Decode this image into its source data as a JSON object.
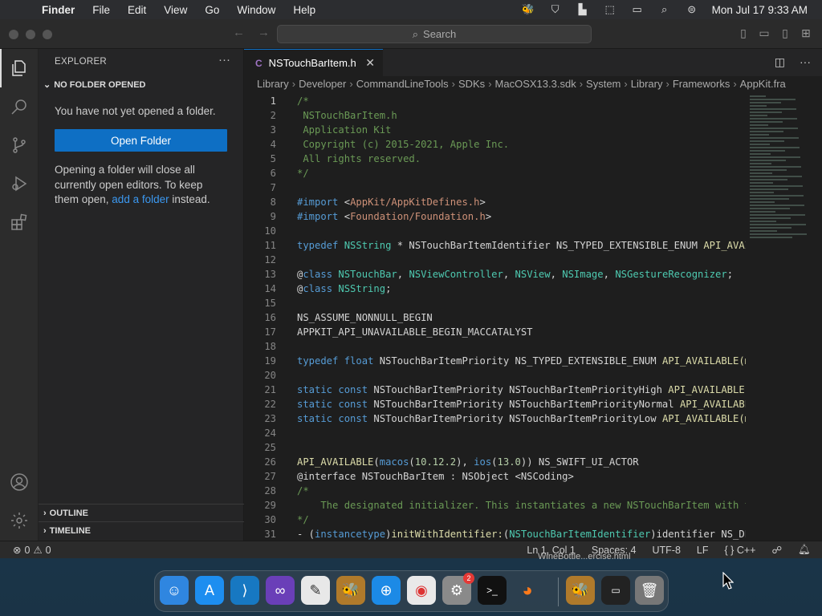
{
  "menubar": {
    "app_name": "Finder",
    "items": [
      "File",
      "Edit",
      "View",
      "Go",
      "Window",
      "Help"
    ],
    "clock": "Mon Jul 17  9:33 AM"
  },
  "titlebar": {
    "search_placeholder": "Search"
  },
  "sidebar": {
    "title": "EXPLORER",
    "more": "···",
    "section": "NO FOLDER OPENED",
    "message": "You have not yet opened a folder.",
    "open_button": "Open Folder",
    "info_before": "Opening a folder will close all currently open editors. To keep them open, ",
    "info_link": "add a folder",
    "info_after": " instead.",
    "outline": "OUTLINE",
    "timeline": "TIMELINE"
  },
  "editor": {
    "tab_lang": "C",
    "tab_label": "NSTouchBarItem.h",
    "breadcrumb": [
      "Library",
      "Developer",
      "CommandLineTools",
      "SDKs",
      "MacOSX13.3.sdk",
      "System",
      "Library",
      "Frameworks",
      "AppKit.fra"
    ],
    "lines": [
      {
        "n": "1",
        "html": "<span class='cm'>/*</span>"
      },
      {
        "n": "2",
        "html": "<span class='cm'> NSTouchBarItem.h</span>"
      },
      {
        "n": "3",
        "html": "<span class='cm'> Application Kit</span>"
      },
      {
        "n": "4",
        "html": "<span class='cm'> Copyright (c) 2015-2021, Apple Inc.</span>"
      },
      {
        "n": "5",
        "html": "<span class='cm'> All rights reserved.</span>"
      },
      {
        "n": "6",
        "html": "<span class='cm'>*/</span>"
      },
      {
        "n": "7",
        "html": ""
      },
      {
        "n": "8",
        "html": "<span class='kw'>#import</span> &lt;<span class='st'>AppKit/AppKitDefines.h</span>&gt;"
      },
      {
        "n": "9",
        "html": "<span class='kw'>#import</span> &lt;<span class='st'>Foundation/Foundation.h</span>&gt;"
      },
      {
        "n": "10",
        "html": ""
      },
      {
        "n": "11",
        "html": "<span class='kw'>typedef</span> <span class='ty'>NSString</span> * NSTouchBarItemIdentifier NS_TYPED_EXTENSIBLE_ENUM <span class='fn'>API_AVAI</span>"
      },
      {
        "n": "12",
        "html": ""
      },
      {
        "n": "13",
        "html": "@<span class='kw'>class</span> <span class='ty'>NSTouchBar</span>, <span class='ty'>NSViewController</span>, <span class='ty'>NSView</span>, <span class='ty'>NSImage</span>, <span class='ty'>NSGestureRecognizer</span>;"
      },
      {
        "n": "14",
        "html": "@<span class='kw'>class</span> <span class='ty'>NSString</span>;"
      },
      {
        "n": "15",
        "html": ""
      },
      {
        "n": "16",
        "html": "NS_ASSUME_NONNULL_BEGIN"
      },
      {
        "n": "17",
        "html": "APPKIT_API_UNAVAILABLE_BEGIN_MACCATALYST"
      },
      {
        "n": "18",
        "html": ""
      },
      {
        "n": "19",
        "html": "<span class='kw'>typedef</span> <span class='kw'>float</span> NSTouchBarItemPriority NS_TYPED_EXTENSIBLE_ENUM <span class='fn'>API_AVAILABLE(m</span>"
      },
      {
        "n": "20",
        "html": ""
      },
      {
        "n": "21",
        "html": "<span class='kw'>static</span> <span class='kw'>const</span> NSTouchBarItemPriority NSTouchBarItemPriorityHigh <span class='fn'>API_AVAILABLE(</span>"
      },
      {
        "n": "22",
        "html": "<span class='kw'>static</span> <span class='kw'>const</span> NSTouchBarItemPriority NSTouchBarItemPriorityNormal <span class='fn'>API_AVAILABL</span>"
      },
      {
        "n": "23",
        "html": "<span class='kw'>static</span> <span class='kw'>const</span> NSTouchBarItemPriority NSTouchBarItemPriorityLow <span class='fn'>API_AVAILABLE(m</span>"
      },
      {
        "n": "24",
        "html": ""
      },
      {
        "n": "25",
        "html": ""
      },
      {
        "n": "26",
        "html": "<span class='fn'>API_AVAILABLE</span>(<span class='kw'>macos</span>(<span class='nm'>10.12.2</span>), <span class='kw'>ios</span>(<span class='nm'>13.0</span>)) NS_SWIFT_UI_ACTOR"
      },
      {
        "n": "27",
        "html": "@interface NSTouchBarItem : NSObject &lt;NSCoding&gt;"
      },
      {
        "n": "28",
        "html": "<span class='cm'>/*</span>"
      },
      {
        "n": "29",
        "html": "<span class='cm'>    The designated initializer. This instantiates a new NSTouchBarItem with t</span>"
      },
      {
        "n": "30",
        "html": "<span class='cm'>*/</span>"
      },
      {
        "n": "31",
        "html": "- (<span class='kw'>instancetype</span>)<span class='fn'>initWithIdentifier:</span>(<span class='ty'>NSTouchBarItemIdentifier</span>)identifier NS_DE"
      }
    ]
  },
  "statusbar": {
    "errors": "0",
    "warnings": "0",
    "position": "Ln 1, Col 1",
    "spaces": "Spaces: 4",
    "encoding": "UTF-8",
    "eol": "LF",
    "language": "C++"
  },
  "dock": {
    "badge_count": "2",
    "label": "WineBottle...ercise.html"
  }
}
